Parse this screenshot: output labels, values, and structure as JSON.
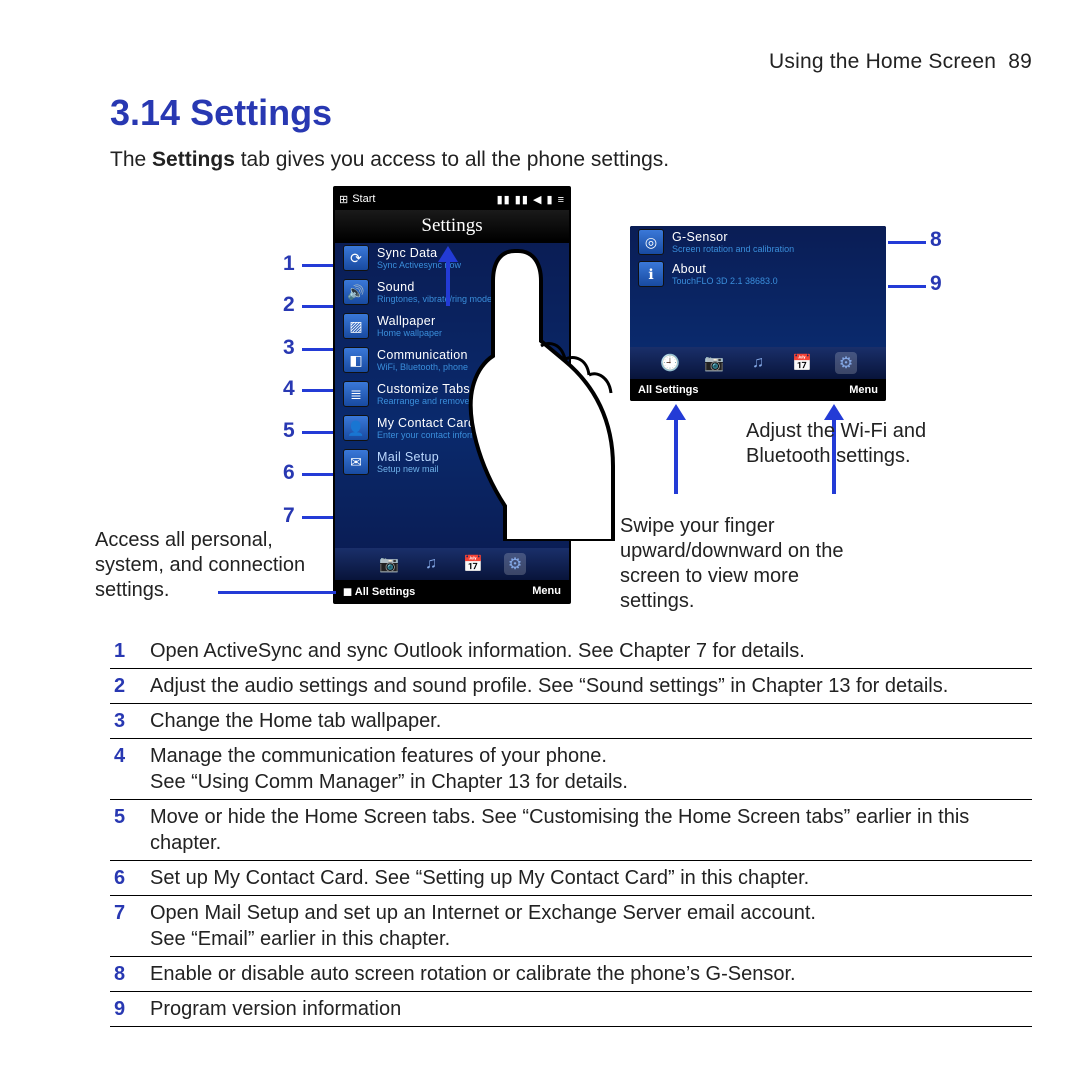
{
  "header": {
    "section": "Using the Home Screen",
    "page": "89"
  },
  "heading": "3.14  Settings",
  "intro_pre": "The ",
  "intro_bold": "Settings",
  "intro_post": " tab gives you access to all the phone settings.",
  "phone": {
    "start": "Start",
    "status_right": "▮▮ ▮▮ ◀ ▮ ≡",
    "title": "Settings",
    "items": [
      {
        "glyph": "⟳",
        "t": "Sync Data",
        "s": "Sync Activesync now"
      },
      {
        "glyph": "🔊",
        "t": "Sound",
        "s": "Ringtones, vibrate/ring mode, system"
      },
      {
        "glyph": "▨",
        "t": "Wallpaper",
        "s": "Home wallpaper"
      },
      {
        "glyph": "◧",
        "t": "Communication",
        "s": "WiFi, Bluetooth, phone"
      },
      {
        "glyph": "≣",
        "t": "Customize Tabs",
        "s": "Rearrange and remove"
      },
      {
        "glyph": "👤",
        "t": "My Contact Card",
        "s": "Enter your contact information"
      },
      {
        "glyph": "✉",
        "t": "Mail Setup",
        "s": "Setup new mail"
      }
    ],
    "tabs": [
      "📷",
      "♫",
      "📅",
      "⚙"
    ],
    "left_soft": "All Settings",
    "right_soft": "Menu"
  },
  "phone2": {
    "items": [
      {
        "glyph": "◎",
        "t": "G-Sensor",
        "s": "Screen rotation and calibration"
      },
      {
        "glyph": "ℹ",
        "t": "About",
        "s": "TouchFLO 3D 2.1 38683.0"
      }
    ],
    "tabs": [
      "🕘",
      "📷",
      "♫",
      "📅",
      "⚙"
    ],
    "left_soft": "All Settings",
    "right_soft": "Menu"
  },
  "callouts": {
    "access_label": "Access all personal, system, and connection settings.",
    "swipe_label": "Swipe your finger upward/downward on the screen to view more settings.",
    "wifi_label": "Adjust the Wi-Fi and Bluetooth settings.",
    "n1": "1",
    "n2": "2",
    "n3": "3",
    "n4": "4",
    "n5": "5",
    "n6": "6",
    "n7": "7",
    "n8": "8",
    "n9": "9"
  },
  "ref": [
    {
      "n": "1",
      "t": "Open ActiveSync and sync Outlook information. See Chapter 7 for details."
    },
    {
      "n": "2",
      "t": "Adjust the audio settings and sound profile. See “Sound settings” in Chapter 13 for details."
    },
    {
      "n": "3",
      "t": "Change the Home tab wallpaper."
    },
    {
      "n": "4",
      "t": "Manage the communication features of your phone.\nSee “Using Comm Manager” in Chapter 13 for details."
    },
    {
      "n": "5",
      "t": "Move or hide the Home Screen tabs. See “Customising the Home Screen tabs” earlier in this chapter."
    },
    {
      "n": "6",
      "t": "Set up My Contact Card. See “Setting up My Contact Card” in this chapter."
    },
    {
      "n": "7",
      "t": "Open Mail Setup and set up an Internet or Exchange Server email account.\nSee “Email” earlier in this chapter."
    },
    {
      "n": "8",
      "t": "Enable or disable auto screen rotation or calibrate the phone’s G-Sensor."
    },
    {
      "n": "9",
      "t": "Program version information"
    }
  ]
}
